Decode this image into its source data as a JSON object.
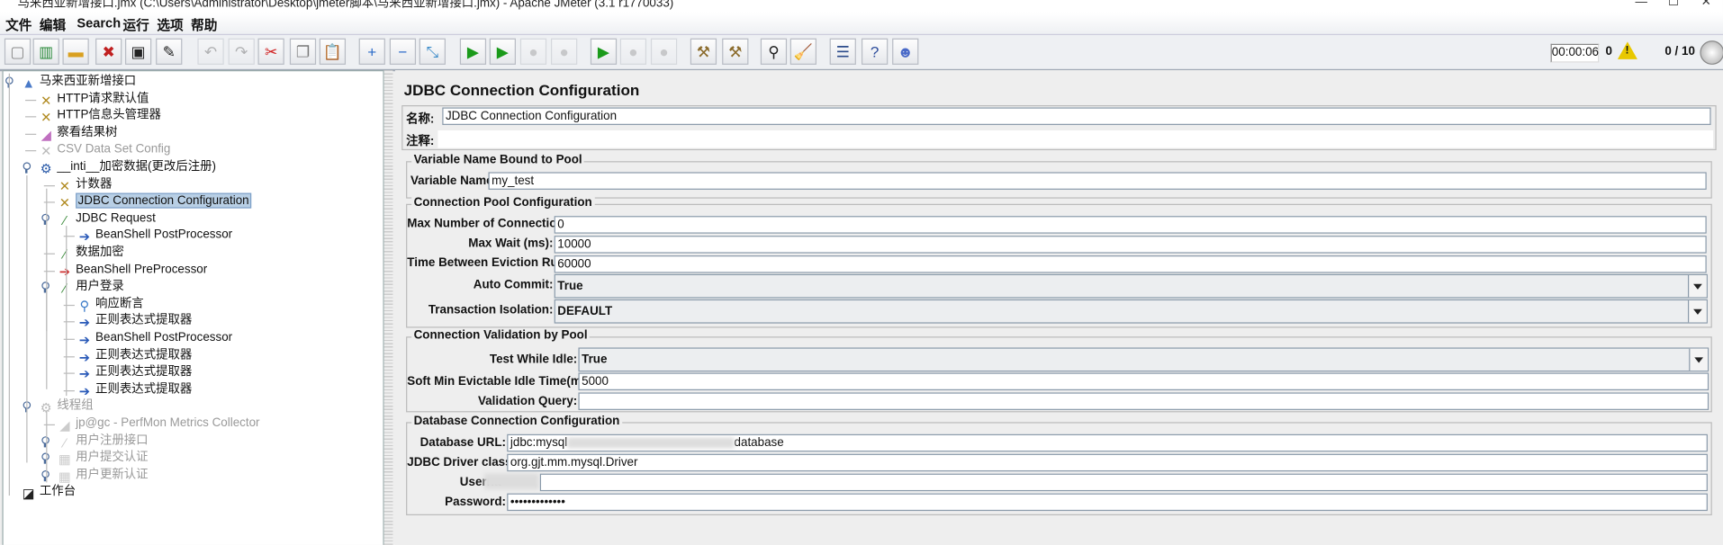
{
  "window": {
    "title": "马来西亚新增接口.jmx (C:\\Users\\Administrator\\Desktop\\jmeter脚本\\马来西亚新增接口.jmx) - Apache JMeter (3.1 r1770033)",
    "controls": [
      "—",
      "☐",
      "✕"
    ]
  },
  "menu": [
    "文件",
    "编辑",
    "Search",
    "运行",
    "选项",
    "帮助"
  ],
  "toolbar": {
    "buttons": [
      {
        "name": "new",
        "glyph": "▢",
        "color": "#888",
        "disabled": false
      },
      {
        "name": "templates",
        "glyph": "▥",
        "color": "#2a8a3a",
        "disabled": false
      },
      {
        "name": "open",
        "glyph": "▬",
        "color": "#d9a020",
        "disabled": false
      },
      {
        "name": "close",
        "glyph": "✖",
        "color": "#c02020",
        "disabled": false
      },
      {
        "name": "save",
        "glyph": "▣",
        "color": "#222",
        "disabled": false
      },
      {
        "name": "save-as",
        "glyph": "✎",
        "color": "#222",
        "disabled": false
      },
      {
        "name": "undo",
        "glyph": "↶",
        "color": "#666",
        "disabled": true
      },
      {
        "name": "redo",
        "glyph": "↷",
        "color": "#666",
        "disabled": true
      },
      {
        "name": "cut",
        "glyph": "✂",
        "color": "#d02020",
        "disabled": false
      },
      {
        "name": "copy",
        "glyph": "❐",
        "color": "#777",
        "disabled": false
      },
      {
        "name": "paste",
        "glyph": "📋",
        "color": "#a07020",
        "disabled": false
      },
      {
        "name": "expand",
        "glyph": "+",
        "color": "#2a6ac8",
        "disabled": false
      },
      {
        "name": "collapse",
        "glyph": "−",
        "color": "#2a6ac8",
        "disabled": false
      },
      {
        "name": "toggle",
        "glyph": "⤡",
        "color": "#3a8ac8",
        "disabled": false
      },
      {
        "name": "start",
        "glyph": "▶",
        "color": "#1a9a1a",
        "disabled": false
      },
      {
        "name": "start-no-pauses",
        "glyph": "▶",
        "color": "#1a9a1a",
        "disabled": false
      },
      {
        "name": "stop",
        "glyph": "●",
        "color": "#999",
        "disabled": true
      },
      {
        "name": "shutdown",
        "glyph": "●",
        "color": "#999",
        "disabled": true
      },
      {
        "name": "remote-start",
        "glyph": "▶",
        "color": "#1a9a1a",
        "disabled": false
      },
      {
        "name": "remote-stop",
        "glyph": "●",
        "color": "#999",
        "disabled": true
      },
      {
        "name": "remote-shutdown",
        "glyph": "●",
        "color": "#999",
        "disabled": true
      },
      {
        "name": "clear",
        "glyph": "⚒",
        "color": "#8a6a2a",
        "disabled": false
      },
      {
        "name": "clear-all",
        "glyph": "⚒",
        "color": "#8a6a2a",
        "disabled": false
      },
      {
        "name": "search",
        "glyph": "⚲",
        "color": "#222",
        "disabled": false
      },
      {
        "name": "reset-search",
        "glyph": "🧹",
        "color": "#c8a020",
        "disabled": false
      },
      {
        "name": "function-helper",
        "glyph": "☰",
        "color": "#2a4a8a",
        "disabled": false
      },
      {
        "name": "help",
        "glyph": "?",
        "color": "#2a4a9a",
        "disabled": false
      },
      {
        "name": "logger",
        "glyph": "☻",
        "color": "#4a6ac8",
        "disabled": false
      }
    ],
    "elapsed_time": "00:00:06",
    "error_count": "0",
    "threads": "0 / 10"
  },
  "tree": [
    {
      "label": "马来西亚新增接口",
      "level": 0,
      "icon": "test-plan-icon",
      "glyph": "▲",
      "color": "#4a7ac8",
      "expander": true
    },
    {
      "label": "HTTP请求默认值",
      "level": 1,
      "icon": "config-element-icon",
      "glyph": "✕",
      "color": "#b08a20"
    },
    {
      "label": "HTTP信息头管理器",
      "level": 1,
      "icon": "config-element-icon",
      "glyph": "✕",
      "color": "#b08a20"
    },
    {
      "label": "察看结果树",
      "level": 1,
      "icon": "listener-icon",
      "glyph": "◢",
      "color": "#c070c0"
    },
    {
      "label": "CSV Data Set Config",
      "level": 1,
      "icon": "config-element-icon",
      "glyph": "✕",
      "color": "#bbb",
      "disabled": true
    },
    {
      "label": "__inti__加密数据(更改后注册)",
      "level": 1,
      "icon": "thread-group-icon",
      "glyph": "⚙",
      "color": "#2a5aa8",
      "expander": true
    },
    {
      "label": "计数器",
      "level": 2,
      "icon": "config-element-icon",
      "glyph": "✕",
      "color": "#b08a20"
    },
    {
      "label": "JDBC Connection Configuration",
      "level": 2,
      "icon": "config-element-icon",
      "glyph": "✕",
      "color": "#b08a20",
      "selected": true
    },
    {
      "label": "JDBC Request",
      "level": 2,
      "icon": "sampler-icon",
      "glyph": "⁄",
      "color": "#3a8a3a",
      "expander": true
    },
    {
      "label": "BeanShell PostProcessor",
      "level": 3,
      "icon": "post-processor-icon",
      "glyph": "➔",
      "color": "#2a5ab8"
    },
    {
      "label": "数据加密",
      "level": 2,
      "icon": "sampler-icon",
      "glyph": "⁄",
      "color": "#3a8a3a"
    },
    {
      "label": "BeanShell PreProcessor",
      "level": 2,
      "icon": "pre-processor-icon",
      "glyph": "➔",
      "color": "#d03030"
    },
    {
      "label": "用户登录",
      "level": 2,
      "icon": "sampler-icon",
      "glyph": "⁄",
      "color": "#3a8a3a",
      "expander": true
    },
    {
      "label": "响应断言",
      "level": 3,
      "icon": "assertion-icon",
      "glyph": "⚲",
      "color": "#3a7ac8"
    },
    {
      "label": "正则表达式提取器",
      "level": 3,
      "icon": "post-processor-icon",
      "glyph": "➔",
      "color": "#2a5ab8"
    },
    {
      "label": "BeanShell PostProcessor",
      "level": 3,
      "icon": "post-processor-icon",
      "glyph": "➔",
      "color": "#2a5ab8"
    },
    {
      "label": "正则表达式提取器",
      "level": 3,
      "icon": "post-processor-icon",
      "glyph": "➔",
      "color": "#2a5ab8"
    },
    {
      "label": "正则表达式提取器",
      "level": 3,
      "icon": "post-processor-icon",
      "glyph": "➔",
      "color": "#2a5ab8"
    },
    {
      "label": "正则表达式提取器",
      "level": 3,
      "icon": "post-processor-icon",
      "glyph": "➔",
      "color": "#2a5ab8"
    },
    {
      "label": "线程组",
      "level": 1,
      "icon": "thread-group-icon",
      "glyph": "⚙",
      "color": "#bbb",
      "disabled": true,
      "expander": true
    },
    {
      "label": "jp@gc - PerfMon Metrics Collector",
      "level": 2,
      "icon": "listener-icon",
      "glyph": "◢",
      "color": "#ccc",
      "disabled": true
    },
    {
      "label": "用户注册接口",
      "level": 2,
      "icon": "sampler-icon",
      "glyph": "⁄",
      "color": "#ccc",
      "disabled": true,
      "expander": true
    },
    {
      "label": "用户提交认证",
      "level": 2,
      "icon": "controller-icon",
      "glyph": "▦",
      "color": "#ccc",
      "disabled": true,
      "expander": true
    },
    {
      "label": "用户更新认证",
      "level": 2,
      "icon": "controller-icon",
      "glyph": "▦",
      "color": "#ccc",
      "disabled": true,
      "expander": true
    },
    {
      "label": "工作台",
      "level": 0.5,
      "icon": "workbench-icon",
      "glyph": "◪",
      "color": "#222"
    }
  ],
  "panel": {
    "title": "JDBC Connection Configuration",
    "name_label": "名称:",
    "name_value": "JDBC Connection Configuration",
    "comment_label": "注释:",
    "comment_value": "",
    "var_group": {
      "legend": "Variable Name Bound to Pool",
      "var_label": "Variable Name:",
      "var_value": "my_test"
    },
    "pool_group": {
      "legend": "Connection Pool Configuration",
      "max_conn_label": "Max Number of Connections:",
      "max_conn_value": "0",
      "max_wait_label": "Max Wait (ms):",
      "max_wait_value": "10000",
      "eviction_label": "Time Between Eviction Runs (ms):",
      "eviction_value": "60000",
      "auto_commit_label": "Auto Commit:",
      "auto_commit_value": "True",
      "isolation_label": "Transaction Isolation:",
      "isolation_value": "DEFAULT"
    },
    "validation_group": {
      "legend": "Connection Validation by Pool",
      "test_idle_label": "Test While Idle:",
      "test_idle_value": "True",
      "soft_min_label": "Soft Min Evictable Idle Time(ms):",
      "soft_min_value": "5000",
      "query_label": "Validation Query:",
      "query_value": ""
    },
    "db_group": {
      "legend": "Database Connection Configuration",
      "url_label": "Database URL:",
      "url_value_start": "jdbc:mysql",
      "url_value_end": "database",
      "driver_label": "JDBC Driver class:",
      "driver_value": "org.gjt.mm.mysql.Driver",
      "username_label": "Userna",
      "password_label": "Password:",
      "password_value": "•••••••••••••"
    }
  }
}
